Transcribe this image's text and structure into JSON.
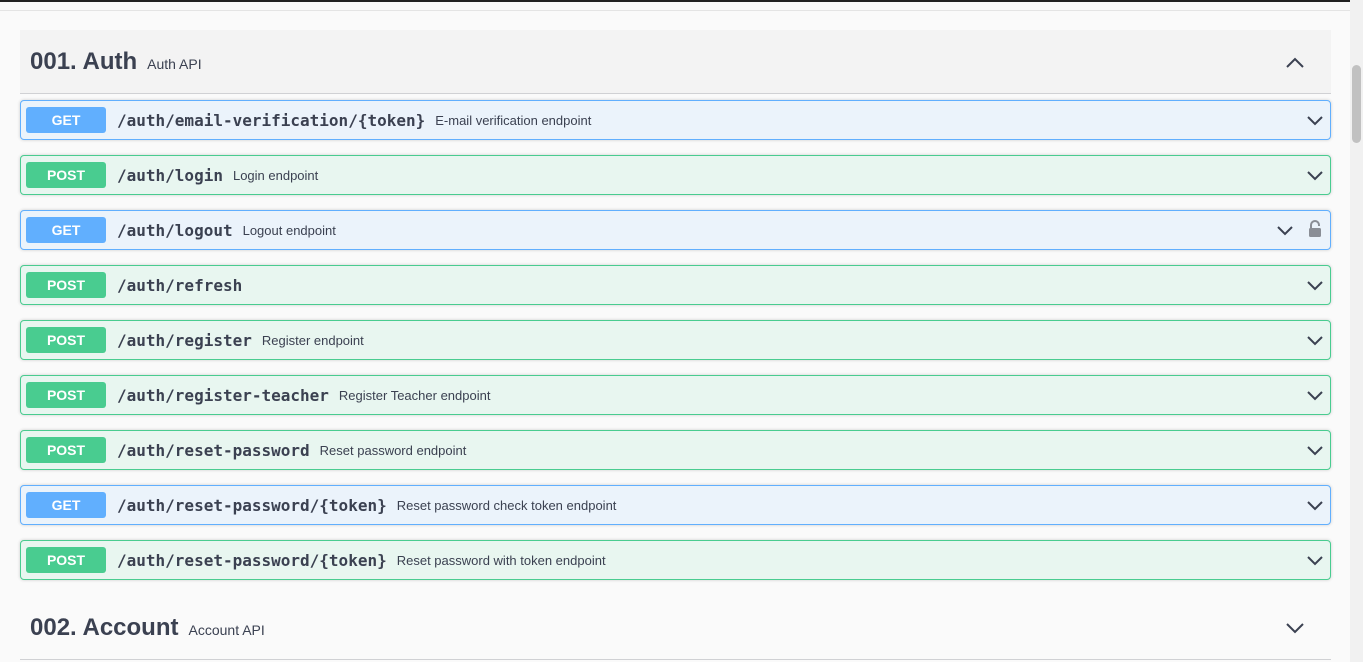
{
  "sections": [
    {
      "name": "001. Auth",
      "description": "Auth API",
      "expanded": true,
      "operations": [
        {
          "method": "GET",
          "path": "/auth/email-verification/{token}",
          "summary": "E-mail verification endpoint",
          "locked": false
        },
        {
          "method": "POST",
          "path": "/auth/login",
          "summary": "Login endpoint",
          "locked": false
        },
        {
          "method": "GET",
          "path": "/auth/logout",
          "summary": "Logout endpoint",
          "locked": true
        },
        {
          "method": "POST",
          "path": "/auth/refresh",
          "summary": "",
          "locked": false
        },
        {
          "method": "POST",
          "path": "/auth/register",
          "summary": "Register endpoint",
          "locked": false
        },
        {
          "method": "POST",
          "path": "/auth/register-teacher",
          "summary": "Register Teacher endpoint",
          "locked": false
        },
        {
          "method": "POST",
          "path": "/auth/reset-password",
          "summary": "Reset password endpoint",
          "locked": false
        },
        {
          "method": "GET",
          "path": "/auth/reset-password/{token}",
          "summary": "Reset password check token endpoint",
          "locked": false
        },
        {
          "method": "POST",
          "path": "/auth/reset-password/{token}",
          "summary": "Reset password with token endpoint",
          "locked": false
        }
      ]
    },
    {
      "name": "002. Account",
      "description": "Account API",
      "expanded": false,
      "operations": []
    }
  ],
  "icons": {
    "collapse": "chevron-up-icon",
    "expand": "chevron-down-icon",
    "lock": "lock-icon"
  },
  "colors": {
    "get": "#61affe",
    "post": "#49cc90"
  }
}
